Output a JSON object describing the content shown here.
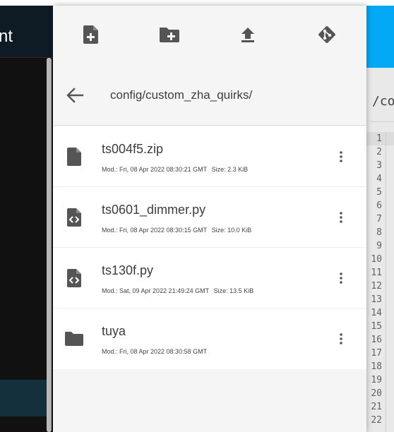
{
  "background": {
    "left_title_fragment": "nt",
    "right_path_fragment": "/co",
    "line_numbers": [
      "1",
      "2",
      "3",
      "4",
      "5",
      "6",
      "7",
      "8",
      "9",
      "10",
      "11",
      "12",
      "13",
      "14",
      "15",
      "16",
      "17",
      "18",
      "19",
      "20",
      "21",
      "22"
    ]
  },
  "toolbar": {
    "buttons": [
      {
        "name": "new-file-button",
        "icon": "file-plus-icon"
      },
      {
        "name": "new-folder-button",
        "icon": "folder-plus-icon"
      },
      {
        "name": "upload-button",
        "icon": "upload-icon"
      },
      {
        "name": "git-button",
        "icon": "git-icon"
      }
    ]
  },
  "path": {
    "current": "config/custom_zha_quirks/"
  },
  "files": [
    {
      "name": "ts004f5.zip",
      "type": "file",
      "icon": "file-icon",
      "modified": "Mod.: Fri, 08 Apr 2022 08:30:21 GMT",
      "size": "Size: 2.3 KiB"
    },
    {
      "name": "ts0601_dimmer.py",
      "type": "code",
      "icon": "file-code-icon",
      "modified": "Mod.: Fri, 08 Apr 2022 08:30:15 GMT",
      "size": "Size: 10.0 KiB"
    },
    {
      "name": "ts130f.py",
      "type": "code",
      "icon": "file-code-icon",
      "modified": "Mod.: Sat, 09 Apr 2022 21:49:24 GMT",
      "size": "Size: 13.5 KiB"
    },
    {
      "name": "tuya",
      "type": "folder",
      "icon": "folder-icon",
      "modified": "Mod.: Fri, 08 Apr 2022 08:30:58 GMT",
      "size": ""
    }
  ],
  "colors": {
    "icon": "#555555",
    "accent": "#03a9f4"
  }
}
